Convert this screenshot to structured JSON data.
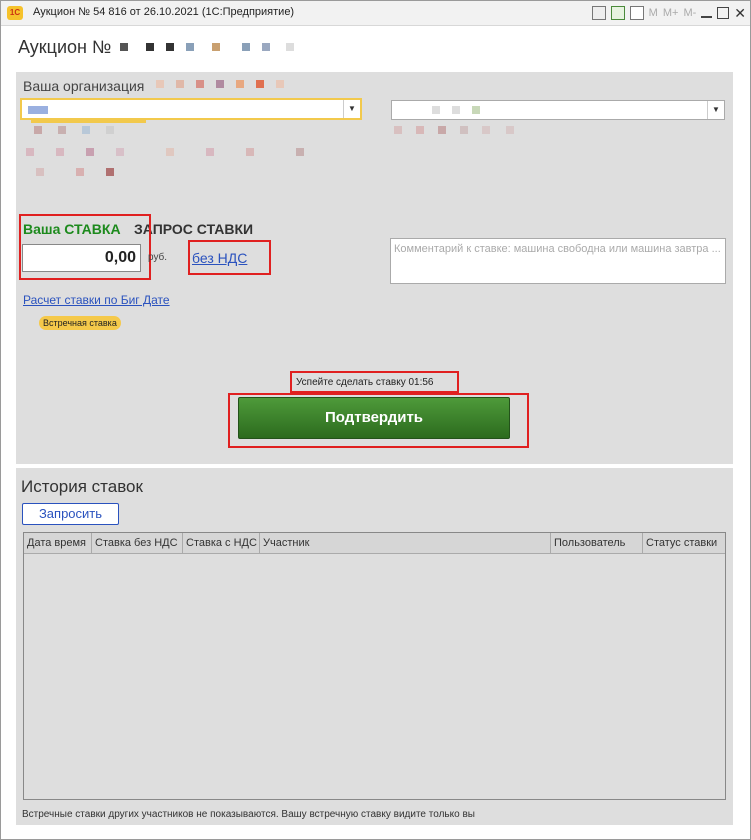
{
  "window": {
    "logo": "1С",
    "title": "Аукцион № 54 816 от 26.10.2021  (1С:Предприятие)",
    "m_labels": [
      "M",
      "M+",
      "M-"
    ]
  },
  "heading": "Аукцион №",
  "org": {
    "label": "Ваша организация"
  },
  "rate": {
    "label_your": "Ваша СТАВКА",
    "label_request": "ЗАПРОС СТАВКИ",
    "value": "0,00",
    "currency": "руб.",
    "vat_link": "без НДС",
    "comment_placeholder": "Комментарий к ставке: машина свободна или машина завтра ...",
    "calc_link": "Расчет ставки по Биг Дате",
    "counter_badge": "Встречная ставка",
    "timer": "Успейте сделать ставку 01:56",
    "confirm_label": "Подтвердить"
  },
  "history": {
    "title": "История ставок",
    "request_button": "Запросить",
    "columns": [
      "Дата время",
      "Ставка без НДС",
      "Ставка с НДС",
      "Участник",
      "Пользователь",
      "Статус ставки"
    ],
    "footer_note": "Встречные ставки других участников не показываются. Вашу встречную ставку видите только вы"
  },
  "colors": {
    "accent_green": "#1d8a1d",
    "link_blue": "#2a52be",
    "highlight_red": "#e02020",
    "badge_yellow": "#f5c94a"
  }
}
